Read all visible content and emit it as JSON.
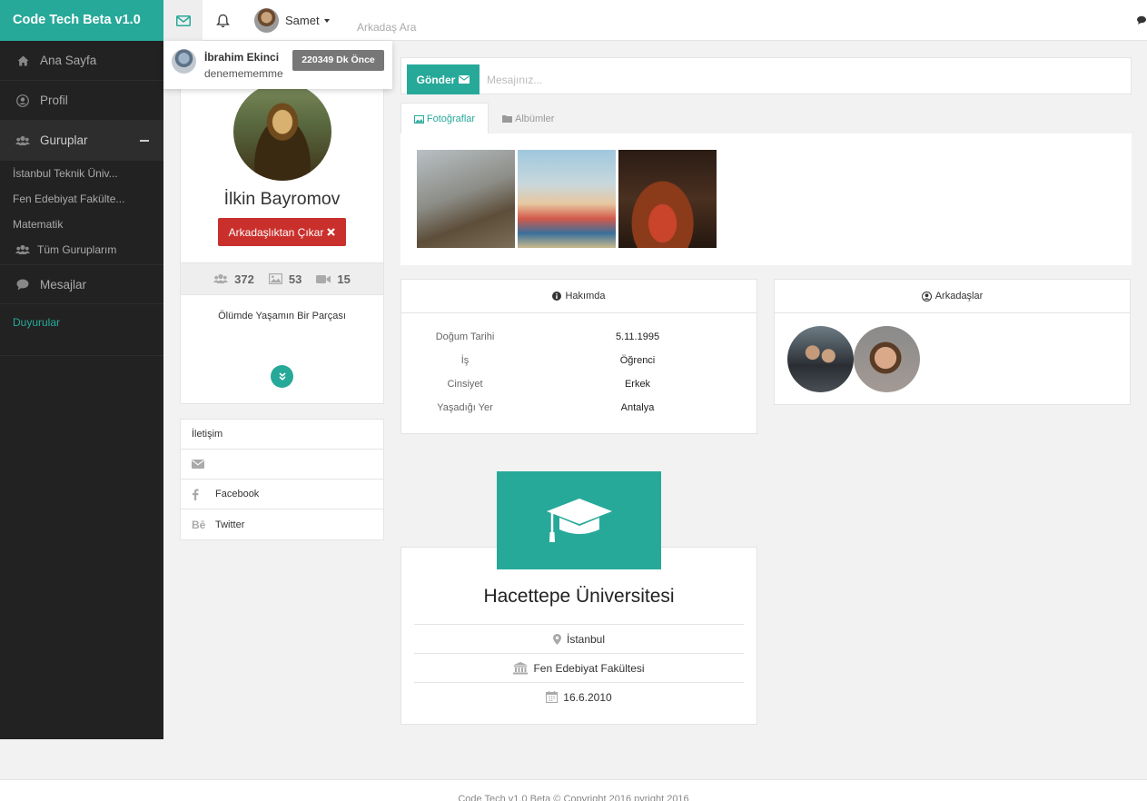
{
  "brand": {
    "title": "Code Tech Beta v1.0"
  },
  "topbar": {
    "username": "Samet",
    "search_placeholder": "Arkadaş Ara"
  },
  "notification": {
    "name": "İbrahim Ekinci",
    "message": "denemememme",
    "time": "220349 Dk Önce"
  },
  "sidebar": {
    "items": [
      {
        "label": "Ana Sayfa",
        "icon": "home-icon"
      },
      {
        "label": "Profil",
        "icon": "user-circle-icon"
      },
      {
        "label": "Guruplar",
        "icon": "users-icon"
      }
    ],
    "groups": [
      "İstanbul Teknik Üniv...",
      "Fen Edebiyat Fakülte...",
      "Matematik"
    ],
    "all_groups": "Tüm Guruplarım",
    "messages": "Mesajlar",
    "announcements": "Duyurular"
  },
  "profile": {
    "name": "İlkin Bayromov",
    "unfriend_label": "Arkadaşlıktan Çıkar",
    "stats": {
      "friends": "372",
      "photos": "53",
      "videos": "15"
    },
    "bio": "Ölümde Yaşamın Bir Parçası"
  },
  "contact": {
    "title": "İletişim",
    "facebook": "Facebook",
    "twitter": "Twitter"
  },
  "message_bar": {
    "send_label": "Gönder",
    "placeholder": "Mesajınız..."
  },
  "tabs": {
    "photos": "Fotoğraflar",
    "albums": "Albümler"
  },
  "about": {
    "title": "Hakımda",
    "rows": [
      {
        "key": "Doğum Tarihi",
        "value": "5.11.1995"
      },
      {
        "key": "İş",
        "value": "Öğrenci"
      },
      {
        "key": "Cinsiyet",
        "value": "Erkek"
      },
      {
        "key": "Yaşadığı Yer",
        "value": "Antalya"
      }
    ]
  },
  "friends": {
    "title": "Arkadaşlar"
  },
  "education": {
    "name": "Hacettepe Üniversitesi",
    "city": "İstanbul",
    "faculty": "Fen Edebiyat Fakültesi",
    "date": "16.6.2010"
  },
  "footer": {
    "text": "Code Tech v1.0 Beta © Copyright 2016 pyright 2016"
  },
  "colors": {
    "accent": "#27a99a",
    "danger": "#c9302c",
    "sidebar": "#222222"
  }
}
